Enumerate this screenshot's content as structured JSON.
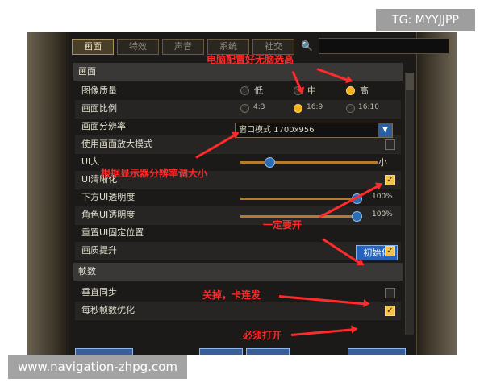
{
  "watermark_tg": "TG: MYYJJPP",
  "watermark_url": "www.navigation-zhpg.com",
  "tabs": [
    "画面",
    "特效",
    "声音",
    "系统",
    "社交"
  ],
  "section_screen": "画面",
  "section_fps": "帧数",
  "rows": {
    "quality": "图像质量",
    "aspect": "画面比例",
    "resolution": "画面分辨率",
    "maximize": "使用画面放大模式",
    "ui_size": "UI大",
    "ui_sharp": "UI清晰化",
    "bottom_ui": "下方UI透明度",
    "role_ui": "角色UI透明度",
    "reset_ui": "重置UI固定位置",
    "quality_up": "画质提升",
    "vsync": "垂直同步",
    "fps_opt": "每秒帧数优化"
  },
  "quality_options": [
    "低",
    "中",
    "高"
  ],
  "quality_selected": "高",
  "aspect_options": [
    "4:3",
    "16:9",
    "16:10"
  ],
  "aspect_selected": "16:9",
  "resolution_value": "窗口模式 1700x956",
  "ui_size_right": "小",
  "bottom_ui_pct": "100%",
  "role_ui_pct": "100%",
  "init_button": "初始化",
  "checkboxes": {
    "maximize": false,
    "ui_sharp": true,
    "quality_up": true,
    "vsync": false,
    "fps_opt": true
  },
  "annotations": {
    "top": "电脑配置好无脑选高",
    "resolution": "根据显示器分辨率调大小",
    "must_on": "一定要开",
    "vsync": "关掉，卡连发",
    "fps_opt": "必须打开"
  }
}
